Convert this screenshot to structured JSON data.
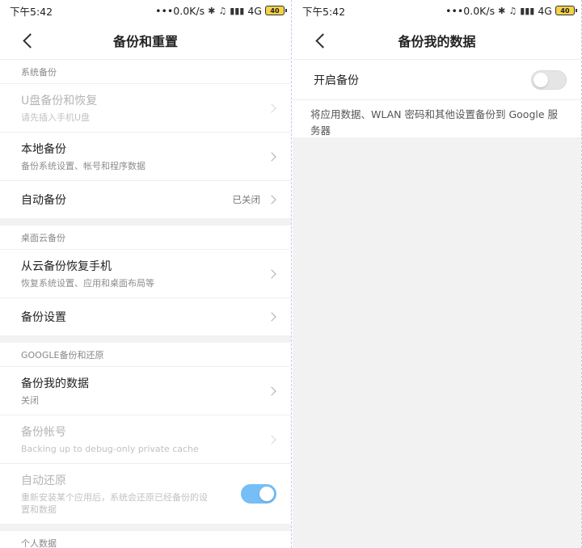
{
  "status": {
    "time": "下午5:42",
    "speed": "•••0.0K/s",
    "network": "4G",
    "battery": "40"
  },
  "left": {
    "title": "备份和重置",
    "sections": [
      {
        "header": "系统备份",
        "rows": [
          {
            "label": "U盘备份和恢复",
            "sub": "请先插入手机U盘"
          },
          {
            "label": "本地备份",
            "sub": "备份系统设置、帐号和程序数据"
          },
          {
            "label": "自动备份",
            "value": "已关闭"
          }
        ]
      },
      {
        "header": "桌面云备份",
        "rows": [
          {
            "label": "从云备份恢复手机",
            "sub": "恢复系统设置、应用和桌面布局等"
          },
          {
            "label": "备份设置"
          }
        ]
      },
      {
        "header": "GOOGLE备份和还原",
        "rows": [
          {
            "label": "备份我的数据",
            "sub": "关闭"
          },
          {
            "label": "备份帐号",
            "sub": "Backing up to debug-only private cache"
          },
          {
            "label": "自动还原",
            "sub": "重新安装某个应用后，系统会还原已经备份的设置和数据"
          }
        ]
      },
      {
        "header": "个人数据"
      }
    ]
  },
  "right": {
    "title": "备份我的数据",
    "toggle_label": "开启备份",
    "description": "将应用数据、WLAN 密码和其他设置备份到 Google 服务器"
  },
  "colors": {
    "toggle_on": "#5fb3f5",
    "toggle_off": "#e5e5e5",
    "section_gap": "#f2f2f2"
  }
}
